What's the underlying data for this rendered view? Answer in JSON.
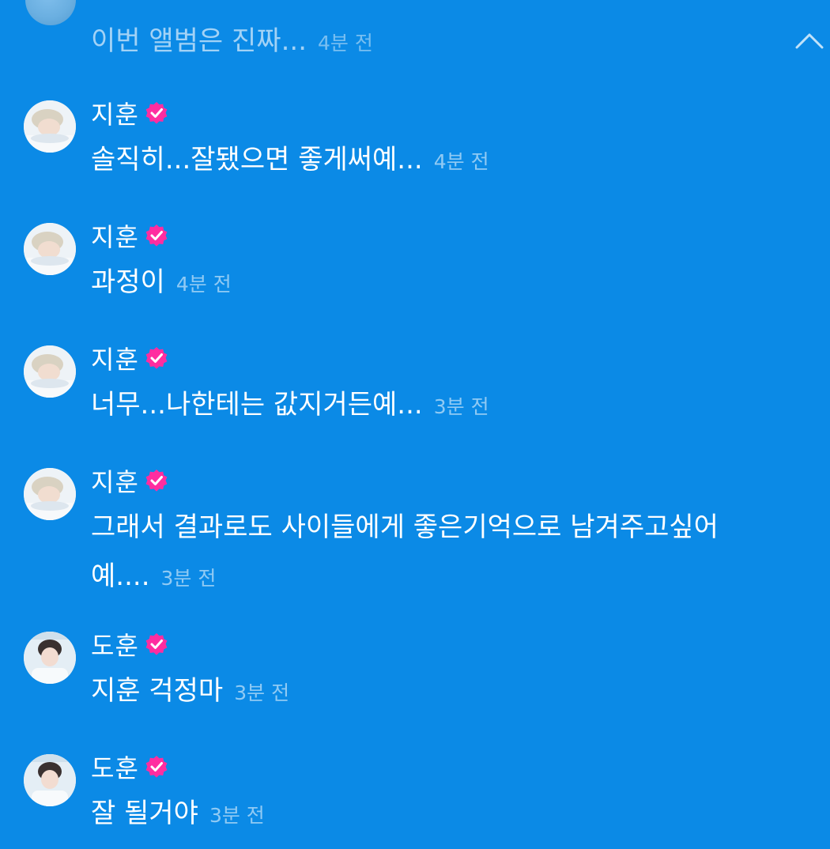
{
  "top_message": {
    "text": "이번 앨범은 진짜...",
    "time": "4분 전",
    "collapse_icon": "chevron-up-icon"
  },
  "verified_badge_color": "#ff2da0",
  "messages": [
    {
      "name": "지훈",
      "text": "솔직히...잘됐으면 좋게써예...",
      "time": "4분 전"
    },
    {
      "name": "지훈",
      "text": "과정이",
      "time": "4분 전"
    },
    {
      "name": "지훈",
      "text": "너무...나한테는 값지거든예...",
      "time": "3분 전"
    },
    {
      "name": "지훈",
      "text": "그래서 결과로도 사이들에게 좋은기억으로 남겨주고싶어예....",
      "time": "3분 전"
    },
    {
      "name": "도훈",
      "text": "지훈 걱정마",
      "time": "3분 전"
    },
    {
      "name": "도훈",
      "text": "잘 될거야",
      "time": "3분 전"
    }
  ]
}
